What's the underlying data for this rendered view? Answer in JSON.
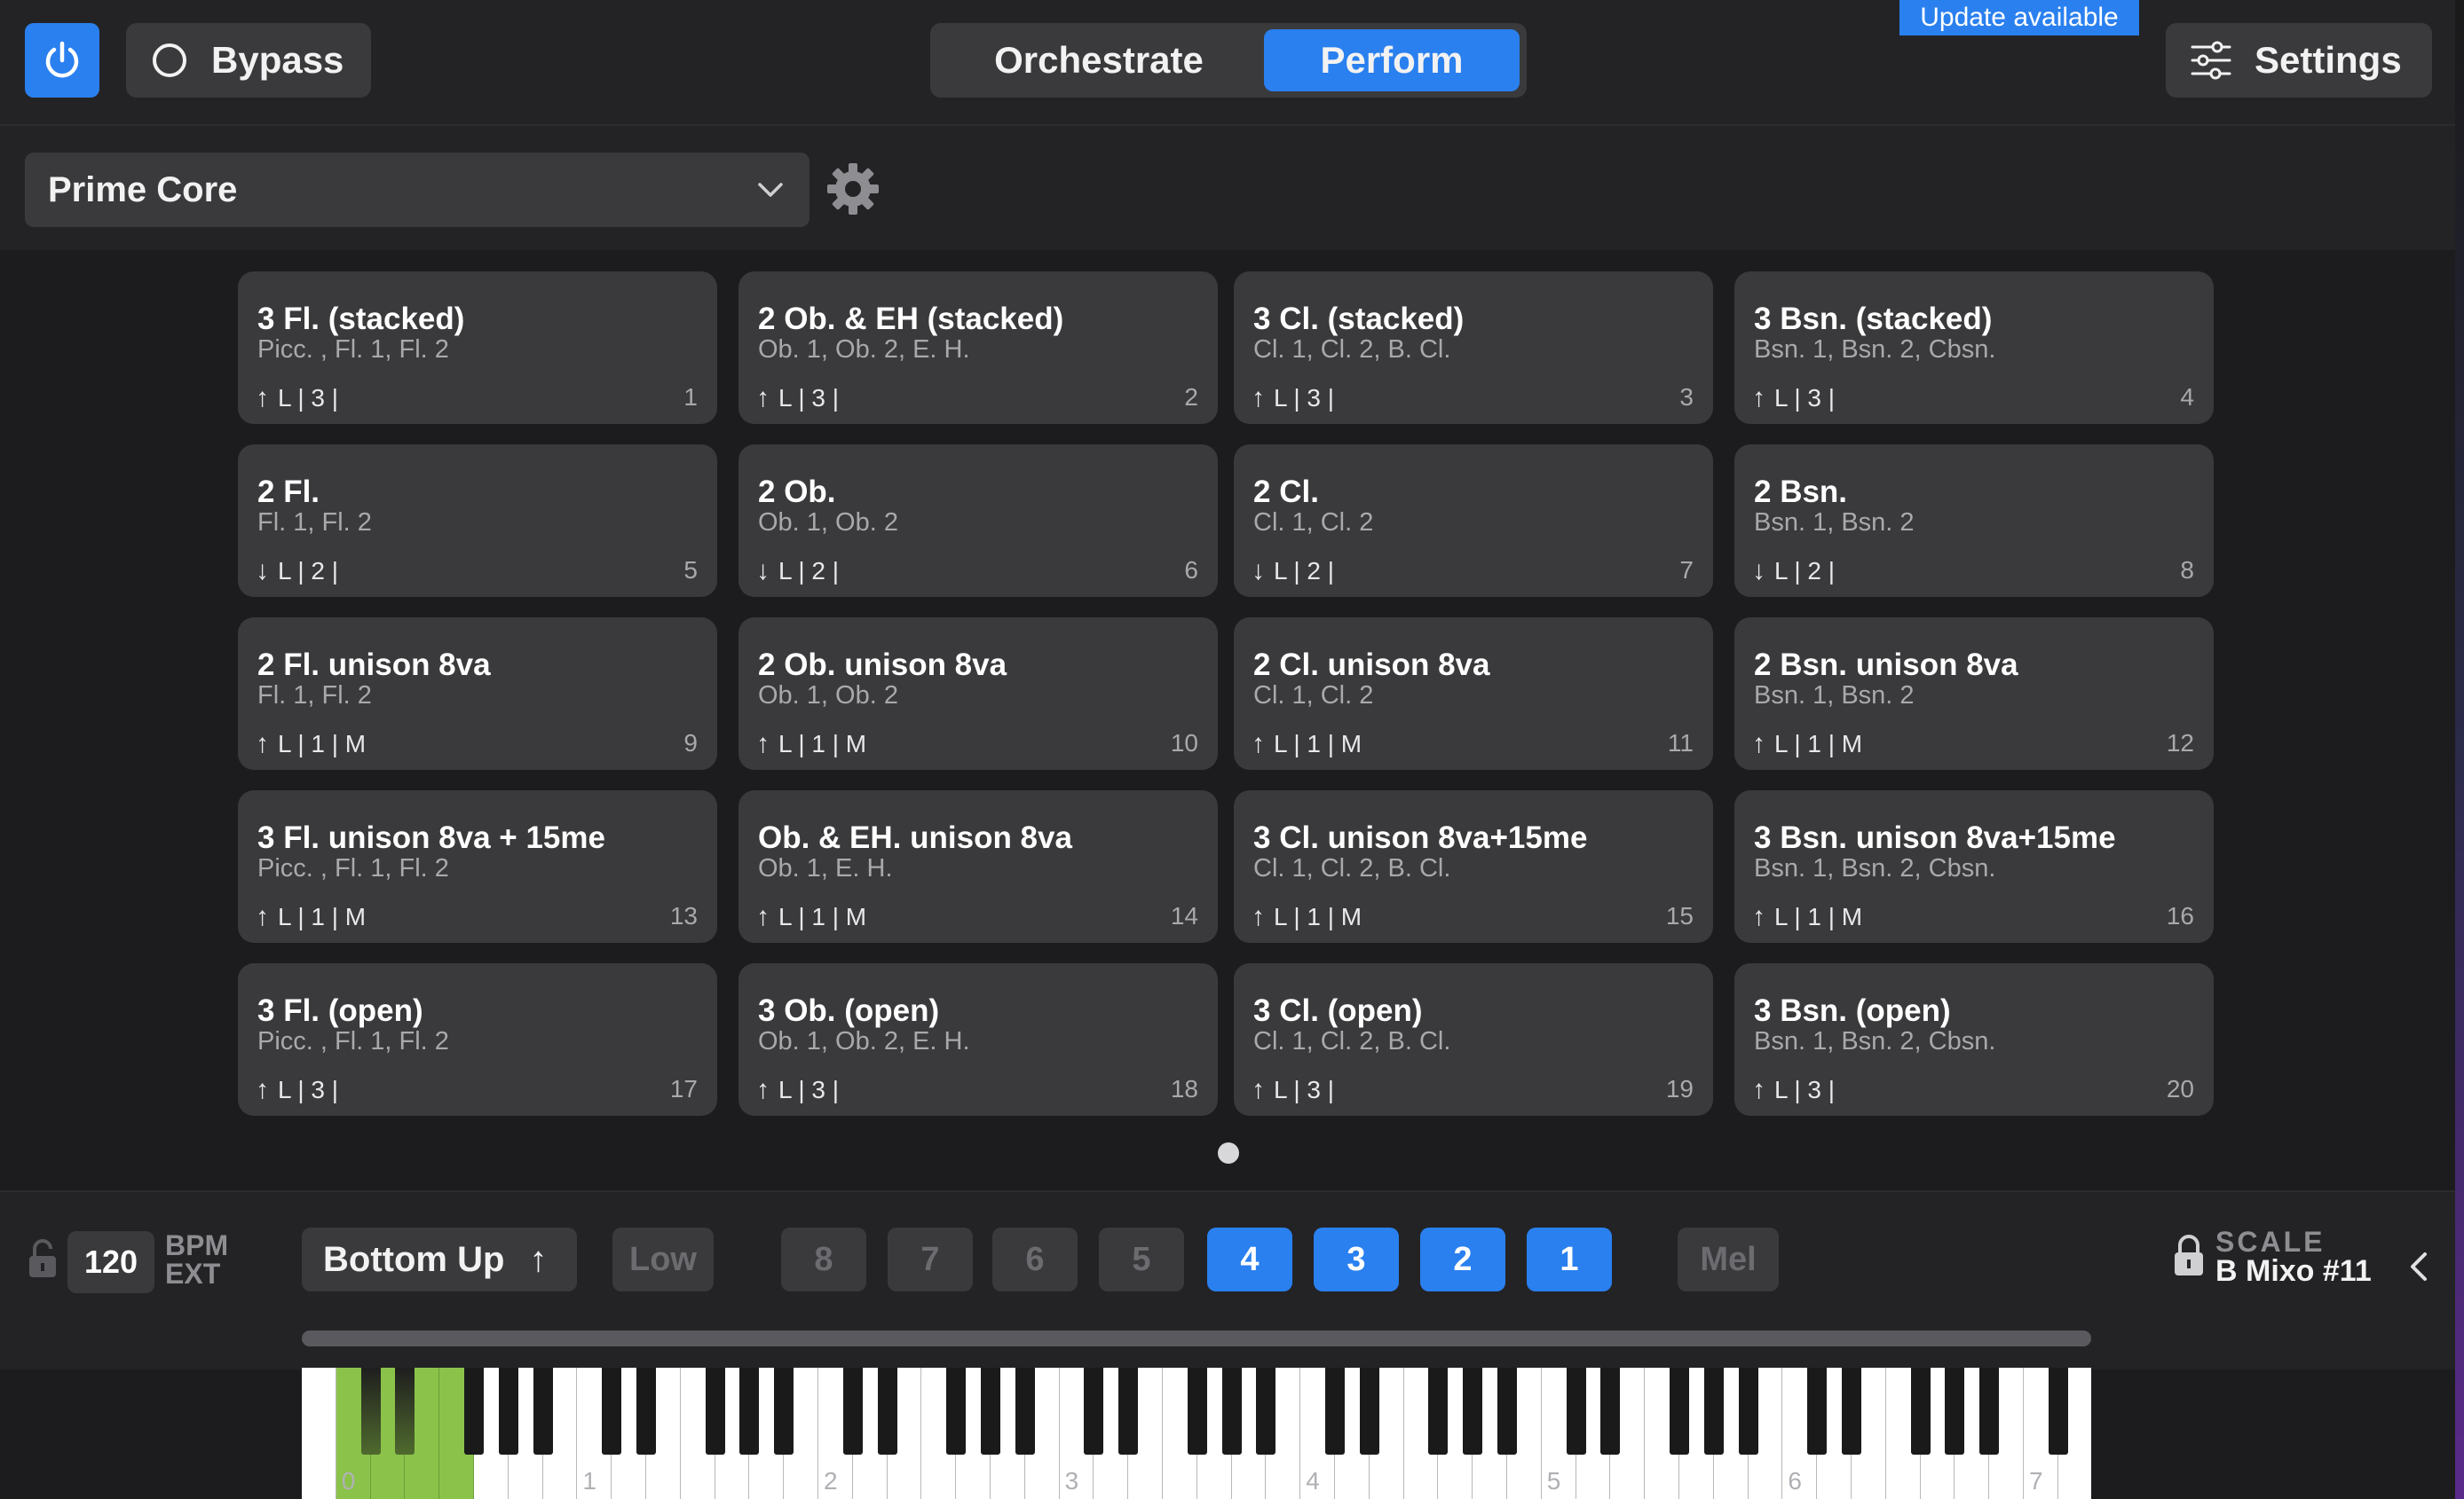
{
  "header": {
    "bypass_label": "Bypass",
    "tabs": [
      "Orchestrate",
      "Perform"
    ],
    "active_tab": "Perform",
    "update_badge": "Update available",
    "settings_label": "Settings"
  },
  "preset": {
    "name": "Prime Core"
  },
  "cards": [
    {
      "title": "3 Fl. (stacked)",
      "sub": "Picc. , Fl. 1, Fl. 2",
      "dir": "up",
      "meta": "L | 3 |",
      "num": "1"
    },
    {
      "title": "2 Ob. & EH (stacked)",
      "sub": "Ob. 1, Ob. 2, E. H.",
      "dir": "up",
      "meta": "L | 3 |",
      "num": "2"
    },
    {
      "title": "3 Cl. (stacked)",
      "sub": "Cl. 1, Cl. 2, B. Cl.",
      "dir": "up",
      "meta": "L | 3 |",
      "num": "3"
    },
    {
      "title": "3 Bsn. (stacked)",
      "sub": "Bsn. 1, Bsn. 2, Cbsn.",
      "dir": "up",
      "meta": "L | 3 |",
      "num": "4"
    },
    {
      "title": "2 Fl.",
      "sub": "Fl. 1, Fl. 2",
      "dir": "down",
      "meta": "L | 2 |",
      "num": "5"
    },
    {
      "title": "2 Ob.",
      "sub": "Ob. 1, Ob. 2",
      "dir": "down",
      "meta": "L | 2 |",
      "num": "6"
    },
    {
      "title": "2 Cl.",
      "sub": "Cl. 1, Cl. 2",
      "dir": "down",
      "meta": "L | 2 |",
      "num": "7"
    },
    {
      "title": "2 Bsn.",
      "sub": "Bsn. 1, Bsn. 2",
      "dir": "down",
      "meta": "L | 2 |",
      "num": "8"
    },
    {
      "title": "2 Fl. unison 8va",
      "sub": "Fl. 1, Fl. 2",
      "dir": "up",
      "meta": "L | 1 | M",
      "num": "9"
    },
    {
      "title": "2 Ob. unison 8va",
      "sub": "Ob. 1, Ob. 2",
      "dir": "up",
      "meta": "L | 1 | M",
      "num": "10"
    },
    {
      "title": "2 Cl. unison 8va",
      "sub": "Cl. 1, Cl. 2",
      "dir": "up",
      "meta": "L | 1 | M",
      "num": "11"
    },
    {
      "title": "2 Bsn. unison 8va",
      "sub": "Bsn. 1, Bsn. 2",
      "dir": "up",
      "meta": "L | 1 | M",
      "num": "12"
    },
    {
      "title": "3 Fl. unison 8va + 15me",
      "sub": "Picc. , Fl. 1, Fl. 2",
      "dir": "up",
      "meta": "L | 1 | M",
      "num": "13"
    },
    {
      "title": "Ob. & EH. unison 8va",
      "sub": "Ob. 1, E. H.",
      "dir": "up",
      "meta": "L | 1 | M",
      "num": "14"
    },
    {
      "title": "3 Cl. unison 8va+15me",
      "sub": "Cl. 1, Cl. 2, B. Cl.",
      "dir": "up",
      "meta": "L | 1 | M",
      "num": "15"
    },
    {
      "title": "3 Bsn. unison 8va+15me",
      "sub": "Bsn. 1, Bsn. 2, Cbsn.",
      "dir": "up",
      "meta": "L | 1 | M",
      "num": "16"
    },
    {
      "title": "3 Fl. (open)",
      "sub": "Picc. , Fl. 1, Fl. 2",
      "dir": "up",
      "meta": "L | 3 |",
      "num": "17"
    },
    {
      "title": "3 Ob. (open)",
      "sub": "Ob. 1, Ob. 2, E. H.",
      "dir": "up",
      "meta": "L | 3 |",
      "num": "18"
    },
    {
      "title": "3 Cl. (open)",
      "sub": "Cl. 1, Cl. 2, B. Cl.",
      "dir": "up",
      "meta": "L | 3 |",
      "num": "19"
    },
    {
      "title": "3 Bsn. (open)",
      "sub": "Bsn. 1, Bsn. 2, Cbsn.",
      "dir": "up",
      "meta": "L | 3 |",
      "num": "20"
    }
  ],
  "controls": {
    "bpm_value": "120",
    "bpm_label": "BPM",
    "ext_label": "EXT",
    "direction_label": "Bottom Up",
    "low_label": "Low",
    "voices": [
      {
        "label": "8",
        "active": false
      },
      {
        "label": "7",
        "active": false
      },
      {
        "label": "6",
        "active": false
      },
      {
        "label": "5",
        "active": false
      },
      {
        "label": "4",
        "active": true
      },
      {
        "label": "3",
        "active": true
      },
      {
        "label": "2",
        "active": true
      },
      {
        "label": "1",
        "active": true
      }
    ],
    "mel_label": "Mel",
    "scale_label": "SCALE",
    "scale_value": "B  Mixo #11"
  },
  "keyboard": {
    "octave_labels": [
      "0",
      "1",
      "2",
      "3",
      "4",
      "5",
      "6",
      "7"
    ],
    "selected_range": "C0–E1",
    "selected_color": "#8bc34a"
  },
  "colors": {
    "accent": "#2a80ef",
    "panel": "#3a3a3c",
    "background": "#1c1c1e"
  }
}
